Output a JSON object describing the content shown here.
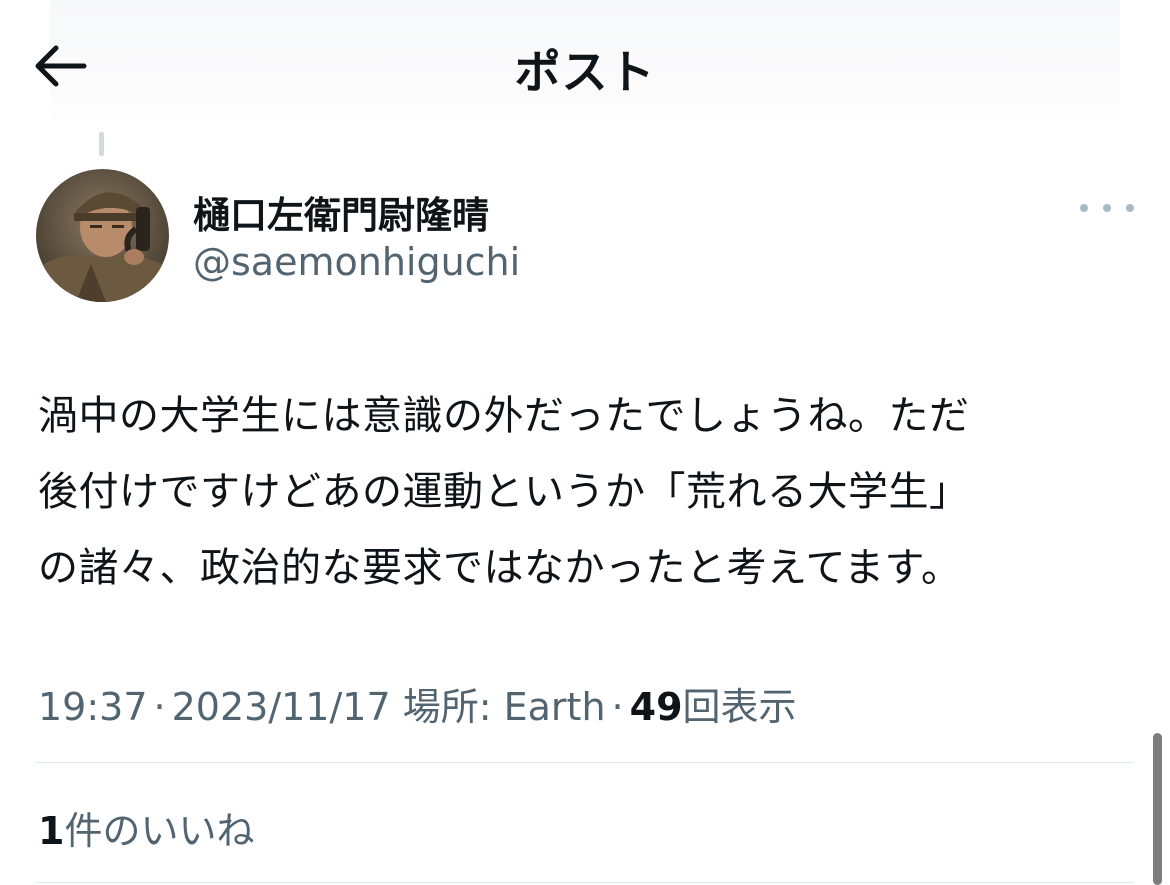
{
  "header": {
    "title": "ポスト",
    "back_icon": "arrow-left-icon"
  },
  "author": {
    "display_name": "樋口左衛門尉隆晴",
    "handle": "@saemonhiguchi",
    "more_icon": "more-horizontal-icon"
  },
  "tweet": {
    "lines": [
      "渦中の大学生には意識の外だったでしょうね。ただ",
      "後付けですけどあの運動というか「荒れる大学生」",
      "の諸々、政治的な要求ではなかったと考えてます。"
    ]
  },
  "meta": {
    "time": "19:37",
    "separator": "·",
    "date": "2023/11/17",
    "location_label": "場所:",
    "location": "Earth",
    "views_count": "49",
    "views_label": "回表示"
  },
  "engagement": {
    "likes_count": "1",
    "likes_label": "件のいいね"
  },
  "colors": {
    "primary_text": "#0f1419",
    "secondary_text": "#536471",
    "divider": "#e1e8ed"
  }
}
